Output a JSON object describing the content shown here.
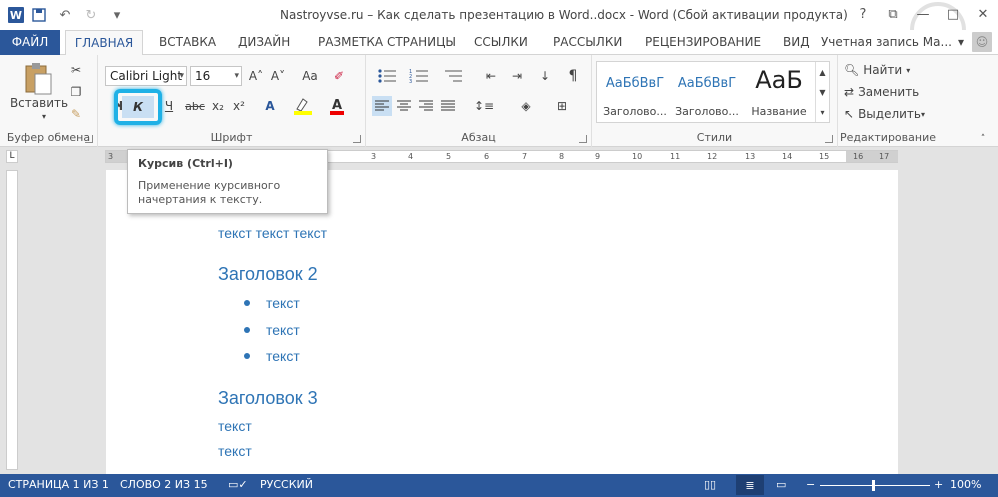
{
  "window": {
    "title": "Nastroyvse.ru – Как сделать презентацию в Word..docx - Word (Сбой активации продукта)",
    "help": "?",
    "restore": "⧉",
    "minimize": "—",
    "maximize": "□",
    "close": "✕"
  },
  "qat": {
    "save_icon": "save-icon",
    "undo_icon": "undo-icon",
    "redo_icon": "redo-icon",
    "more": "▾"
  },
  "tabs": {
    "file": "ФАЙЛ",
    "home": "ГЛАВНАЯ",
    "insert": "ВСТАВКА",
    "design": "ДИЗАЙН",
    "layout": "РАЗМЕТКА СТРАНИЦЫ",
    "references": "ССЫЛКИ",
    "mailings": "РАССЫЛКИ",
    "review": "РЕЦЕНЗИРОВАНИЕ",
    "view": "ВИД",
    "account": "Учетная запись Ма..."
  },
  "ribbon": {
    "clipboard": {
      "paste": "Вставить",
      "label": "Буфер обмена"
    },
    "font": {
      "name": "Calibri Light",
      "size": "16",
      "label": "Шрифт",
      "bold": "Ж",
      "italic": "К",
      "underline": "Ч",
      "strike": "abc",
      "sub": "x₂",
      "sup": "x²",
      "grow": "A˄",
      "shrink": "A˅",
      "case": "Aa",
      "clear": "A"
    },
    "paragraph": {
      "label": "Абзац",
      "pilcrow": "¶"
    },
    "styles": {
      "label": "Стили",
      "items": [
        {
          "sample": "АаБбВвГ",
          "name": "Заголово..."
        },
        {
          "sample": "АаБбВвГ",
          "name": "Заголово..."
        },
        {
          "sample": "АаБ",
          "name": "Название"
        }
      ]
    },
    "editing": {
      "label": "Редактирование",
      "find": "Найти",
      "replace": "Заменить",
      "select": "Выделить"
    }
  },
  "tooltip": {
    "title": "Курсив (Ctrl+I)",
    "description": "Применение курсивного начертания к тексту."
  },
  "ruler": {
    "ticks": [
      "3",
      "1",
      "2",
      "1",
      "2",
      "3",
      "4",
      "5",
      "6",
      "7",
      "8",
      "9",
      "10",
      "11",
      "12",
      "13",
      "14",
      "15",
      "16",
      "17"
    ]
  },
  "document": {
    "line1": "текст текст текст",
    "heading2": "Заголовок 2",
    "bullets": [
      "текст",
      "текст",
      "текст"
    ],
    "heading3": "Заголовок 3",
    "line2": "текст",
    "line3": "текст"
  },
  "status": {
    "page": "СТРАНИЦА 1 ИЗ 1",
    "words": "СЛОВО 2 ИЗ 15",
    "language": "РУССКИЙ",
    "zoom": "100%",
    "zoom_minus": "−",
    "zoom_plus": "+"
  }
}
